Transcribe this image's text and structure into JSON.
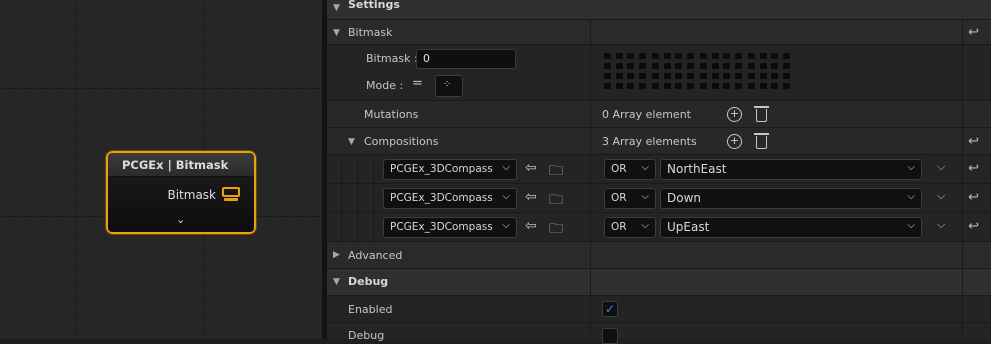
{
  "graph": {
    "node": {
      "title": "PCGEx | Bitmask",
      "pin_label": "Bitmask",
      "expand_icon": "chevron-down-icon"
    },
    "accent": "#e9a012"
  },
  "details": {
    "settings_label": "Settings",
    "bitmask_category": "Bitmask",
    "bitmask_field_label": "Bitmask :",
    "bitmask_value": "0",
    "mode_label": "Mode :",
    "mutations_label": "Mutations",
    "mutations_count": "0 Array element",
    "compositions_label": "Compositions",
    "compositions_count": "3 Array elements",
    "compositions": [
      {
        "source": "PCGEx_3DCompass",
        "op": "OR",
        "value": "NorthEast"
      },
      {
        "source": "PCGEx_3DCompass",
        "op": "OR",
        "value": "Down"
      },
      {
        "source": "PCGEx_3DCompass",
        "op": "OR",
        "value": "UpEast"
      }
    ],
    "advanced_label": "Advanced",
    "debug_category": "Debug",
    "enabled_label": "Enabled",
    "enabled_checked": true,
    "debug_label": "Debug",
    "checkbox_color": "#2e8ee0"
  }
}
